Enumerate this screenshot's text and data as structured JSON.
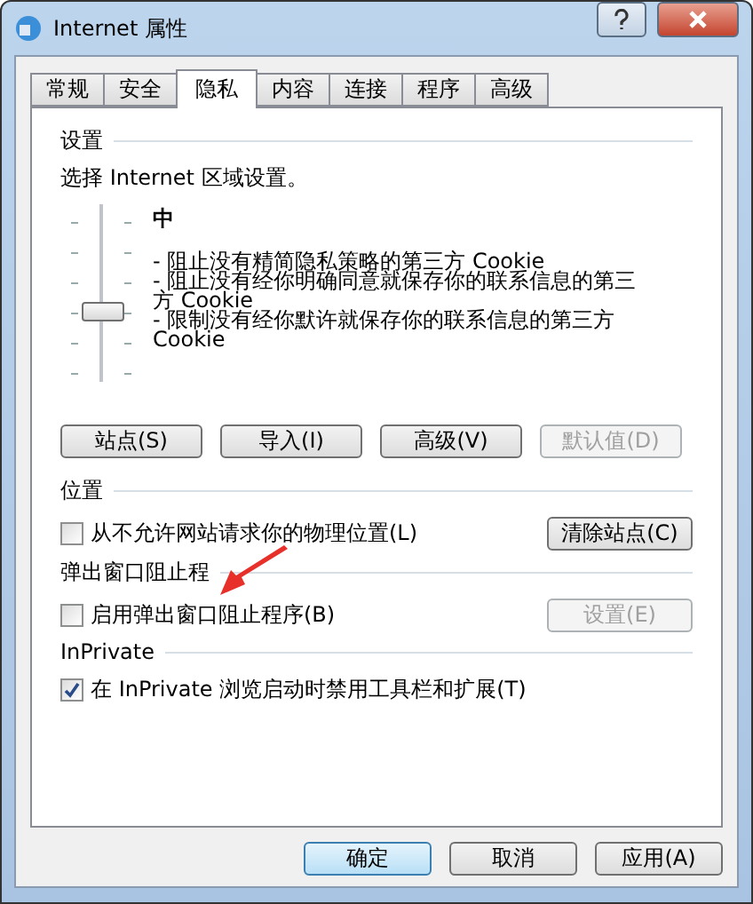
{
  "window": {
    "title": "Internet 属性"
  },
  "tabs": [
    {
      "label": "常规",
      "selected": false
    },
    {
      "label": "安全",
      "selected": false
    },
    {
      "label": "隐私",
      "selected": true
    },
    {
      "label": "内容",
      "selected": false
    },
    {
      "label": "连接",
      "selected": false
    },
    {
      "label": "程序",
      "selected": false
    },
    {
      "label": "高级",
      "selected": false
    }
  ],
  "settings": {
    "heading": "设置",
    "intro": "选择 Internet 区域设置。",
    "slider": {
      "level": 0.4
    },
    "level_name": "中",
    "description": [
      "- 阻止没有精简隐私策略的第三方 Cookie",
      "- 阻止没有经你明确同意就保存你的联系信息的第三方 Cookie",
      "- 限制没有经你默许就保存你的联系信息的第三方 Cookie"
    ],
    "buttons": [
      {
        "label": "站点(S)",
        "disabled": false
      },
      {
        "label": "导入(I)",
        "disabled": false
      },
      {
        "label": "高级(V)",
        "disabled": false
      },
      {
        "label": "默认值(D)",
        "disabled": true
      }
    ]
  },
  "location": {
    "heading": "位置",
    "checkbox": {
      "label": "从不允许网站请求你的物理位置(L)",
      "checked": false
    },
    "button": {
      "label": "清除站点(C)",
      "disabled": false
    }
  },
  "popup": {
    "heading": "弹出窗口阻止程",
    "checkbox": {
      "label": "启用弹出窗口阻止程序(B)",
      "checked": false
    },
    "button": {
      "label": "设置(E)",
      "disabled": true
    }
  },
  "inprivate": {
    "heading": "InPrivate",
    "checkbox": {
      "label": "在 InPrivate 浏览启动时禁用工具栏和扩展(T)",
      "checked": true
    }
  },
  "footer": [
    {
      "label": "确定",
      "default": true
    },
    {
      "label": "取消",
      "default": false
    },
    {
      "label": "应用(A)",
      "default": false
    }
  ]
}
